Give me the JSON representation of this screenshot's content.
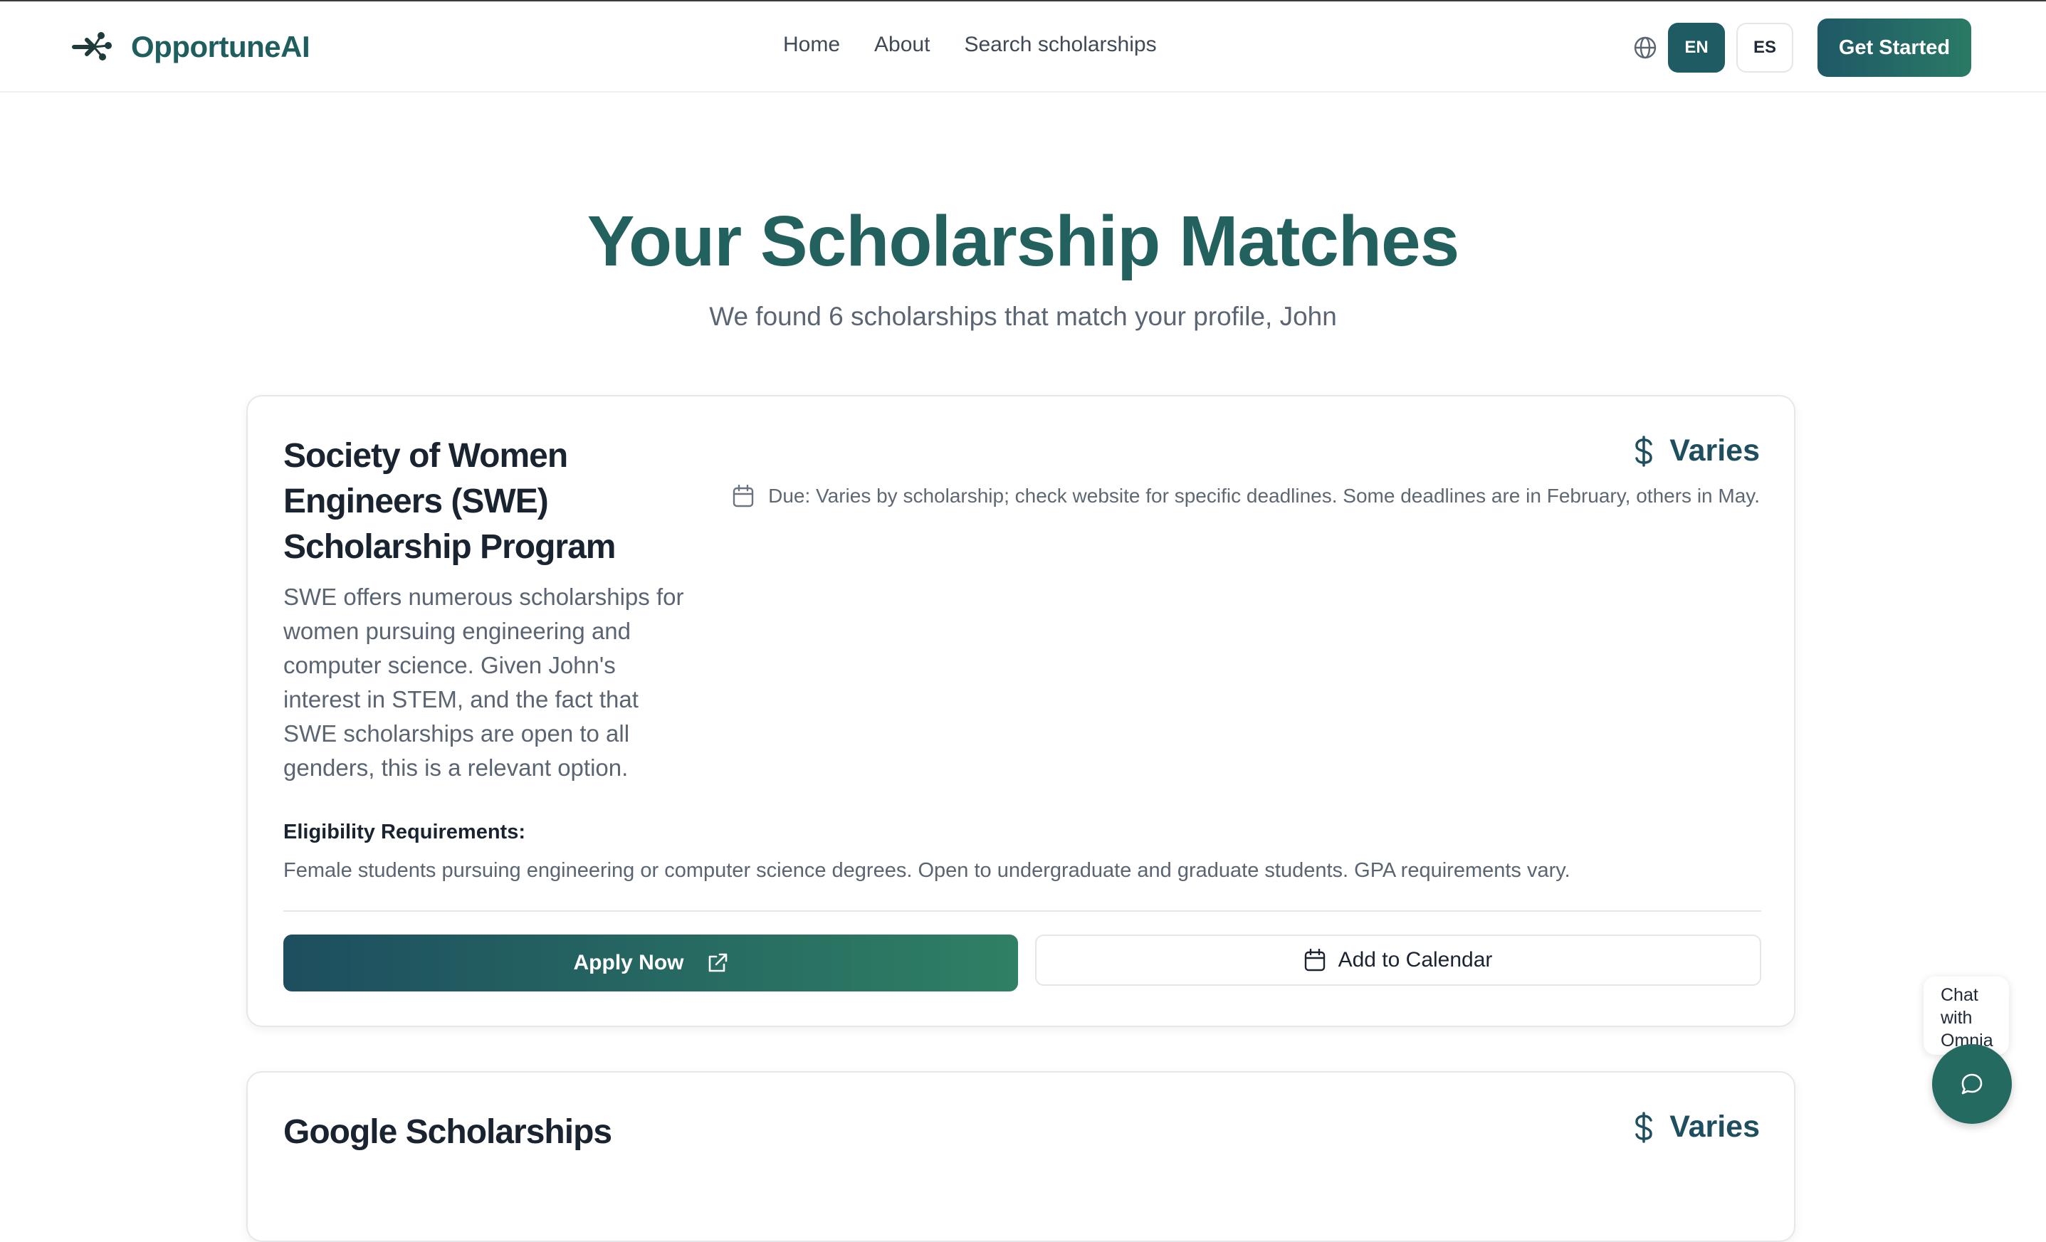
{
  "app": {
    "name": "OpportuneAI"
  },
  "nav": {
    "items": [
      "Home",
      "About",
      "Search scholarships"
    ]
  },
  "language": {
    "en": "EN",
    "es": "ES",
    "selected": "EN"
  },
  "header": {
    "cta_label": "Get Started"
  },
  "hero": {
    "title": "Your Scholarship Matches",
    "subtitle": "We found 6 scholarships that match your profile, John"
  },
  "scholarships": [
    {
      "title": "Society of Women Engineers (SWE) Scholarship Program",
      "amount": "Varies",
      "due": "Due: Varies by scholarship; check website for specific deadlines. Some deadlines are in February, others in May.",
      "description": "SWE offers numerous scholarships for women pursuing engineering and computer science. Given John's interest in STEM, and the fact that SWE scholarships are open to all genders, this is a relevant option.",
      "eligibility_label": "Eligibility Requirements:",
      "eligibility": "Female students pursuing engineering or computer science degrees. Open to undergraduate and graduate students. GPA requirements vary.",
      "apply_label": "Apply Now",
      "calendar_label": "Add to Calendar"
    },
    {
      "title": "Google Scholarships",
      "amount": "Varies"
    }
  ],
  "chat": {
    "label": "Chat with Omnia"
  },
  "colors": {
    "brand": "#1f5e5e",
    "accent": "#2a7a66"
  }
}
